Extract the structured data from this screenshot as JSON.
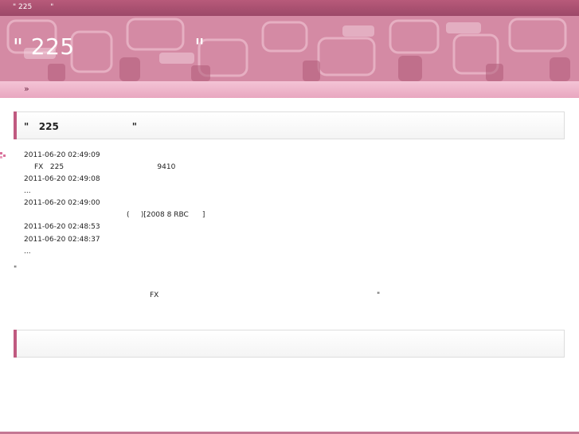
{
  "window": {
    "tab_title": "\" 225        \""
  },
  "header": {
    "title": "\" 225                \""
  },
  "breadcrumb": {
    "icon_text": "»"
  },
  "article": {
    "title": "\"   225                      \"",
    "entries": [
      {
        "text": "2011-06-20 02:49:09"
      },
      {
        "text": "FX   225                                         9410"
      },
      {
        "text": "2011-06-20 02:49:08"
      },
      {
        "text": "..."
      },
      {
        "text": "2011-06-20 02:49:00"
      },
      {
        "text": "(     )[2008 8 RBC      ]"
      },
      {
        "text": "2011-06-20 02:48:53"
      },
      {
        "text": "2011-06-20 02:48:37"
      },
      {
        "text": "..."
      }
    ],
    "quote_open": "\"",
    "fx_text": "FX",
    "quote_close": "\""
  },
  "colors": {
    "top_bar": "#a8506f",
    "banner": "#d48aa4",
    "crumb_bar": "#eeb0c8",
    "accent": "#c05a80",
    "footer": "#c47894"
  },
  "icons": {
    "bullet": "pink-bullet-icon",
    "breadcrumb": "double-chevron-icon"
  }
}
